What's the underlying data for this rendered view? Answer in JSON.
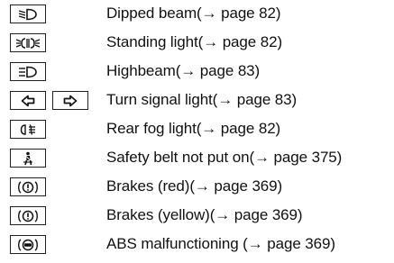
{
  "indicators": [
    {
      "icon": "dipped-beam-icon",
      "label": "Dipped beam(→ page 82)"
    },
    {
      "icon": "standing-light-icon",
      "label": "Standing light(→ page 82)"
    },
    {
      "icon": "high-beam-icon",
      "label": "Highbeam(→ page 83)"
    },
    {
      "icon": "turn-signal-icon",
      "label": "Turn signal light(→ page 83)"
    },
    {
      "icon": "rear-fog-light-icon",
      "label": "Rear fog light(→ page 82)"
    },
    {
      "icon": "seat-belt-icon",
      "label": "Safety belt not put on(→ page 375)"
    },
    {
      "icon": "brake-icon",
      "label": "Brakes (red)(→ page 369)"
    },
    {
      "icon": "brake-icon",
      "label": "Brakes (yellow)(→ page 369)"
    },
    {
      "icon": "abs-icon",
      "label": "ABS malfunctioning (→ page 369)"
    }
  ]
}
